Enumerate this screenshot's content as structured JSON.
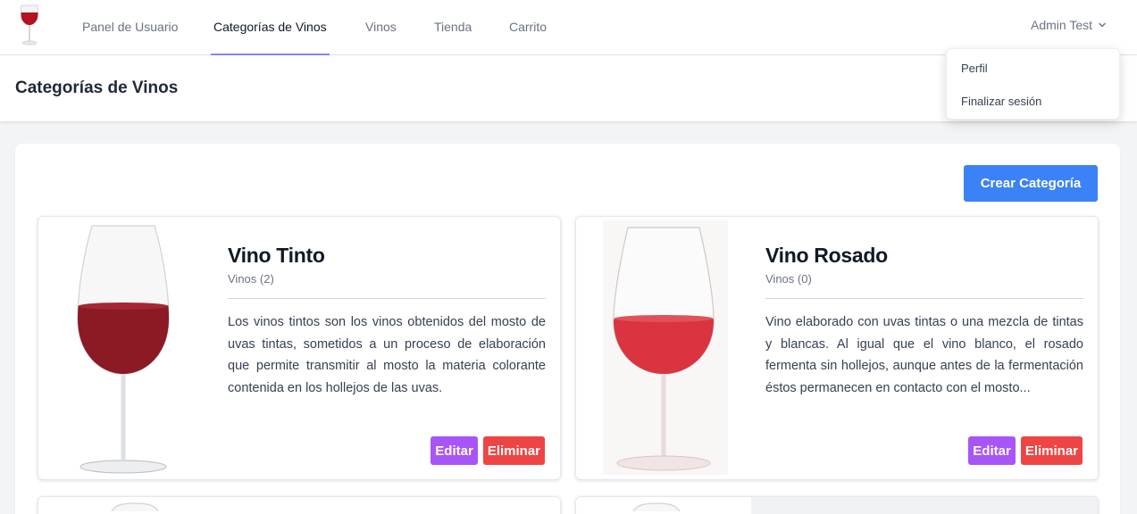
{
  "nav": {
    "links": [
      "Panel de Usuario",
      "Categorías de Vinos",
      "Vinos",
      "Tienda",
      "Carrito"
    ],
    "user": "Admin Test"
  },
  "dropdown": {
    "items": [
      "Perfil",
      "Finalizar sesión"
    ]
  },
  "header": {
    "title": "Categorías de Vinos"
  },
  "main": {
    "create_label": "Crear Categoría",
    "cards": [
      {
        "title": "Vino Tinto",
        "count": "Vinos (2)",
        "description": "Los vinos tintos son los vinos obtenidos del mosto de uvas tintas, sometidos a un proceso de elaboración que permite transmitir al mosto la materia colorante contenida en los hollejos de las uvas.",
        "wine_color": "#8b1a24",
        "edit_label": "Editar",
        "delete_label": "Eliminar"
      },
      {
        "title": "Vino Rosado",
        "count": "Vinos (0)",
        "description": "Vino elaborado con uvas tintas o una mezcla de tintas y blancas. Al igual que el vino blanco, el rosado fermenta sin hollejos, aunque antes de la fermentación éstos permanecen en contacto con el mosto...",
        "wine_color": "#d9343f",
        "edit_label": "Editar",
        "delete_label": "Eliminar"
      }
    ]
  },
  "colors": {
    "primary": "#3b82f6",
    "edit": "#a855f7",
    "delete": "#ef4444",
    "active_underline": "#818cf8"
  }
}
